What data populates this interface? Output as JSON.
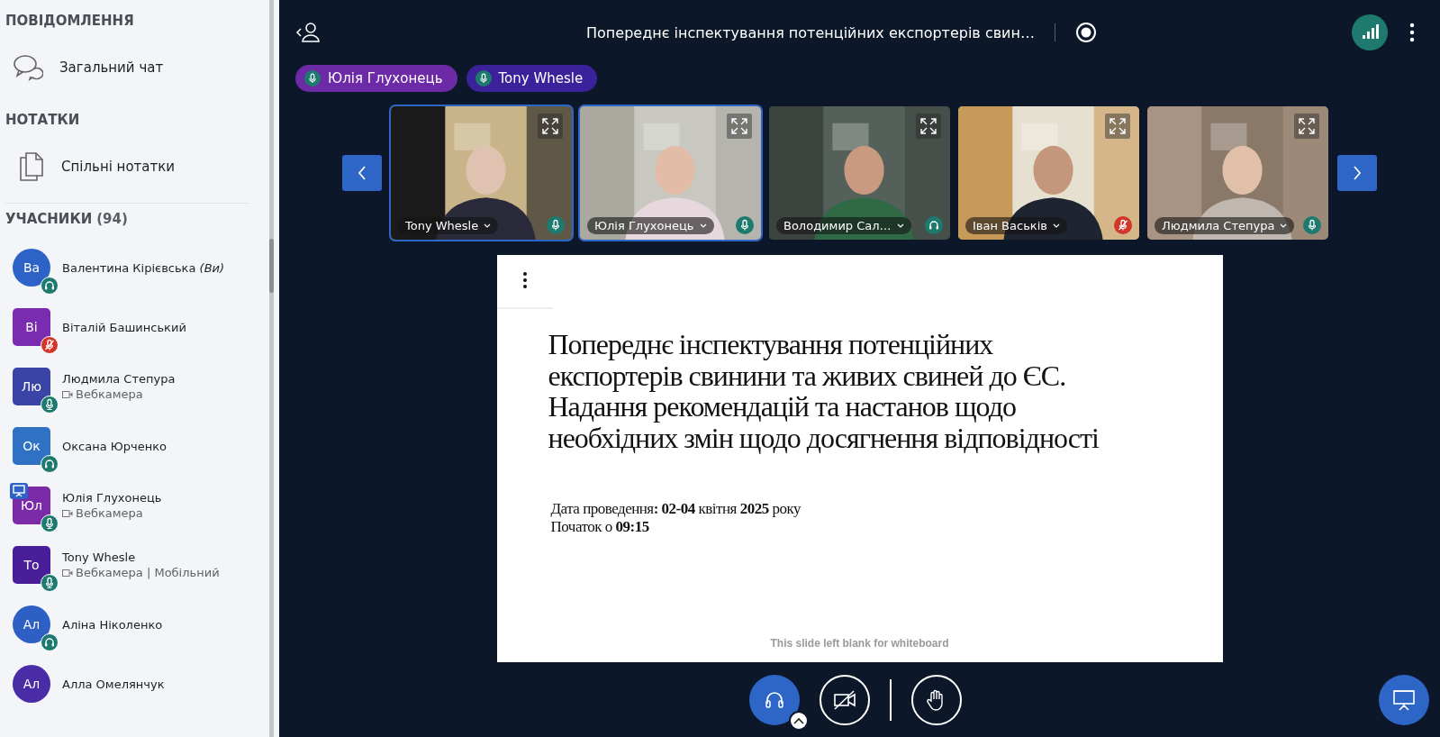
{
  "sidebar": {
    "messages_heading": "ПОВІДОМЛЕННЯ",
    "chat_item": "Загальний чат",
    "notes_heading": "НОТАТКИ",
    "notes_item": "Спільні нотатки",
    "participants_heading": "УЧАСНИКИ",
    "participants_count": "(94)",
    "participants": [
      {
        "initials": "Ва",
        "name": "Валентина Кірієвська *(Ви)*",
        "moderator": false,
        "color": "#2d62c6",
        "kind": "headset",
        "presenter": false
      },
      {
        "initials": "Ві",
        "name": "Віталій Башинський",
        "moderator": true,
        "color": "#7b2bb0",
        "kind": "muted",
        "presenter": false
      },
      {
        "initials": "Лю",
        "name": "Людмила Степура",
        "status": "Вебкамера",
        "moderator": true,
        "color": "#3a44a6",
        "kind": "mic",
        "presenter": false
      },
      {
        "initials": "Ок",
        "name": "Оксана Юрченко",
        "moderator": true,
        "color": "#2f71c2",
        "kind": "headset",
        "presenter": false
      },
      {
        "initials": "Юл",
        "name": "Юлія Глухонець",
        "status": "Вебкамера",
        "moderator": true,
        "color": "#7b2ba8",
        "kind": "mic",
        "presenter": true
      },
      {
        "initials": "То",
        "name": "Tony Whesle",
        "status": "Вебкамера | Мобільний",
        "moderator": true,
        "color": "#4a1e98",
        "kind": "mic",
        "presenter": false
      },
      {
        "initials": "Ал",
        "name": "Аліна Ніколенко",
        "moderator": false,
        "color": "#2d5fc4",
        "kind": "headset",
        "presenter": false
      },
      {
        "initials": "Ал",
        "name": "Алла Омелянчук",
        "moderator": false,
        "color": "#4a2ca6",
        "kind": "none",
        "presenter": false
      }
    ]
  },
  "topbar": {
    "title": "Попереднє інспектування потенційних експортерів свин…"
  },
  "talking": [
    {
      "name": "Юлія Глухонець",
      "color": "#6d2aa6"
    },
    {
      "name": "Tony Whesle",
      "color": "#3b229a"
    }
  ],
  "videos": [
    {
      "name": "Tony Whesle",
      "kind": "mic",
      "selected": true
    },
    {
      "name": "Юлія Глухонець",
      "kind": "mic",
      "selected": true
    },
    {
      "name": "Володимир Сал…",
      "kind": "headset",
      "selected": false
    },
    {
      "name": "Іван Васьків",
      "kind": "muted",
      "selected": false
    },
    {
      "name": "Людмила Степура",
      "kind": "mic",
      "selected": false
    }
  ],
  "slide": {
    "title": "Попереднє інспектування потенційних\nекспортерів свинини та живих свиней до ЄС.\nНадання рекомендацій та настанов щодо\nнеобхідних змін щодо досягнення відповідності",
    "lines": [
      "Дата проведення**: 02-04** квітня **2025** року",
      "Початок о **09:15**"
    ],
    "footer": "This slide left blank for whiteboard"
  }
}
